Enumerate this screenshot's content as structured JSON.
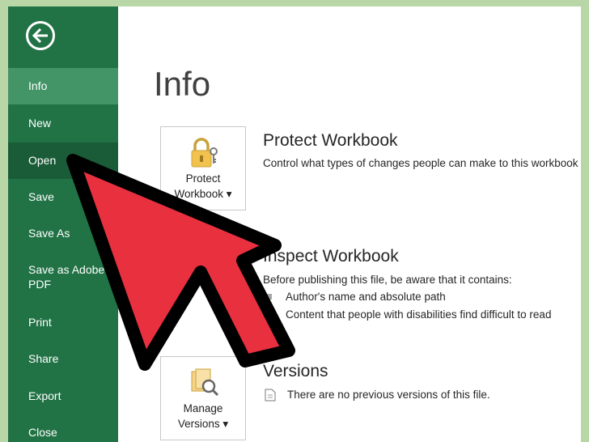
{
  "sidebar": {
    "items": [
      {
        "label": "Info"
      },
      {
        "label": "New"
      },
      {
        "label": "Open"
      },
      {
        "label": "Save"
      },
      {
        "label": "Save As"
      },
      {
        "label": "Save as Adobe"
      },
      {
        "label": "PDF"
      },
      {
        "label": "Print"
      },
      {
        "label": "Share"
      },
      {
        "label": "Export"
      },
      {
        "label": "Close"
      }
    ]
  },
  "main": {
    "title": "Info",
    "protect": {
      "tile_line1": "Protect",
      "tile_line2": "Workbook ▾",
      "heading": "Protect Workbook",
      "description": "Control what types of changes people can make to this workbook"
    },
    "inspect": {
      "heading": "Inspect Workbook",
      "intro": "Before publishing this file, be aware that it contains:",
      "bullets": [
        "Author's name and absolute path",
        "Content that people with disabilities find difficult to read"
      ]
    },
    "versions": {
      "tile_line1": "Manage",
      "tile_line2": "Versions ▾",
      "heading": "Versions",
      "description": "There are no previous versions of this file."
    }
  },
  "colors": {
    "sidebar": "#217346",
    "selected": "#439467",
    "arrow_fill": "#e8303f",
    "page_border": "#b9d6a6"
  }
}
